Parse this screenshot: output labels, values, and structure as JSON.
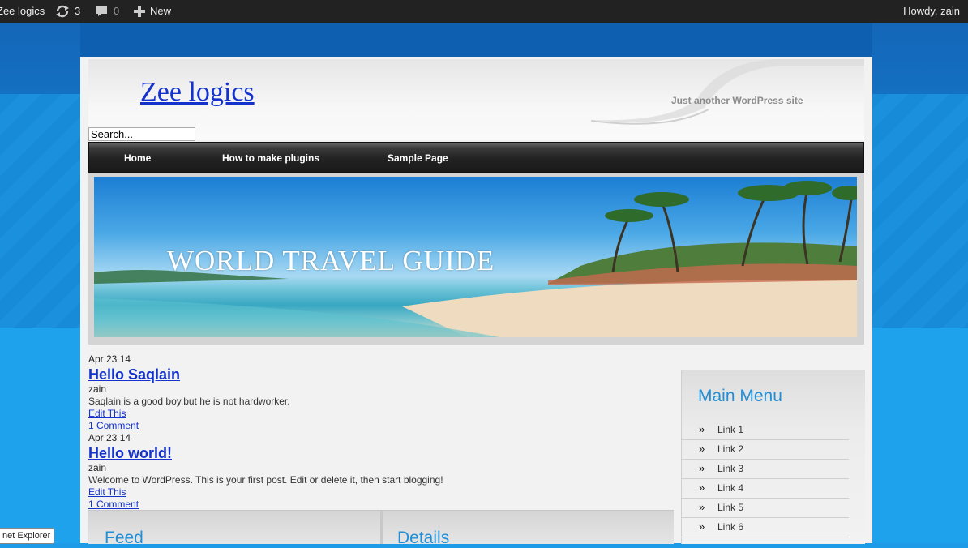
{
  "adminbar": {
    "site_name": "Zee logics",
    "updates_count": "3",
    "comments_count": "0",
    "new_label": "New",
    "howdy": "Howdy, zain"
  },
  "header": {
    "site_title": "Zee logics",
    "tagline": "Just another WordPress site",
    "search_placeholder": "Search..."
  },
  "nav": {
    "items": [
      "Home",
      "How to make plugins",
      "Sample Page"
    ]
  },
  "banner": {
    "text": "WORLD TRAVEL GUIDE"
  },
  "posts": [
    {
      "date": "Apr 23 14",
      "title": "Hello Saqlain",
      "author": "zain",
      "body": "Saqlain is a good boy,but he is not hardworker.",
      "edit": "Edit This",
      "comments": "1 Comment"
    },
    {
      "date": "Apr 23 14",
      "title": "Hello world!",
      "author": "zain",
      "body": "Welcome to WordPress. This is your first post. Edit or delete it, then start blogging!",
      "edit": "Edit This",
      "comments": "1 Comment"
    }
  ],
  "sidebar": {
    "title": "Main Menu",
    "arrow": "»",
    "links": [
      "Link 1",
      "Link 2",
      "Link 3",
      "Link 4",
      "Link 5",
      "Link 6"
    ]
  },
  "widgets": {
    "feed_title": "Feed",
    "details_title": "Details"
  },
  "tooltip": "net Explorer"
}
